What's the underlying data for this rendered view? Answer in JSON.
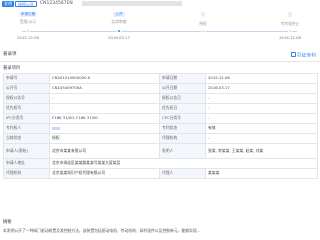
{
  "header": {
    "tag_primary": "发明",
    "tag_secondary": "授权公告",
    "patent_number": "CN1234567EN"
  },
  "timeline": [
    {
      "badge": "申请日期",
      "status": "受理/公示",
      "date": "2015.12.08",
      "active": false
    },
    {
      "badge": "公开",
      "status": "实质审查",
      "date": "2016.03.17",
      "active": true
    },
    {
      "badge": "",
      "status": "授权",
      "date": "",
      "active": false
    },
    {
      "badge": "",
      "status": "专利权终止",
      "date": "2016.12.08",
      "active": false
    }
  ],
  "section": {
    "title": "著录项",
    "action_label": "引证专利",
    "sub_title": "著录项目"
  },
  "rows": [
    {
      "k1": "申请号",
      "v1": "CN201510900000.X",
      "k2": "申请日期",
      "v2": "2015.12.08"
    },
    {
      "k1": "公开号",
      "v1": "CN105409700A",
      "k2": "公开日期",
      "v2": "2016.03.17"
    },
    {
      "k1": "授权公告号",
      "v1": "-",
      "k2": "授权公告日",
      "v2": "-"
    },
    {
      "k1": "优先权号",
      "v1": "-",
      "k2": "优先权日",
      "v2": "-"
    },
    {
      "k1": "IPC分类号",
      "v1": "F16K 31/00; F16K 37/00",
      "k2": "CPC分类号",
      "v2": "-"
    },
    {
      "k1": "专利权人",
      "v1": "",
      "k2": "专利状态",
      "v2": "有效"
    },
    {
      "k1": "当前状态",
      "v1": "授权",
      "k2": "代理机构",
      "v2": "-"
    },
    {
      "k1": "申请人(原始)",
      "v1": "北京市某某有限公司",
      "k2": "发明人",
      "v2": "张某, 李某某, 王某某, 赵某, 刘某"
    },
    {
      "k1": "申请人地址",
      "v1": "北京市海淀区某某路某某号某某大厦某层",
      "k2": "",
      "v2": ""
    },
    {
      "k1": "代理机构",
      "v1": "北京某某知识产权代理有限公司",
      "k2": "代理人",
      "v2": "某某某"
    }
  ],
  "abstract": {
    "title": "摘要",
    "text": "本发明公开了一种阀门驱动装置及其控制方法，该装置包括驱动电机、传动机构、阀杆组件以及控制单元，能够实现..."
  }
}
